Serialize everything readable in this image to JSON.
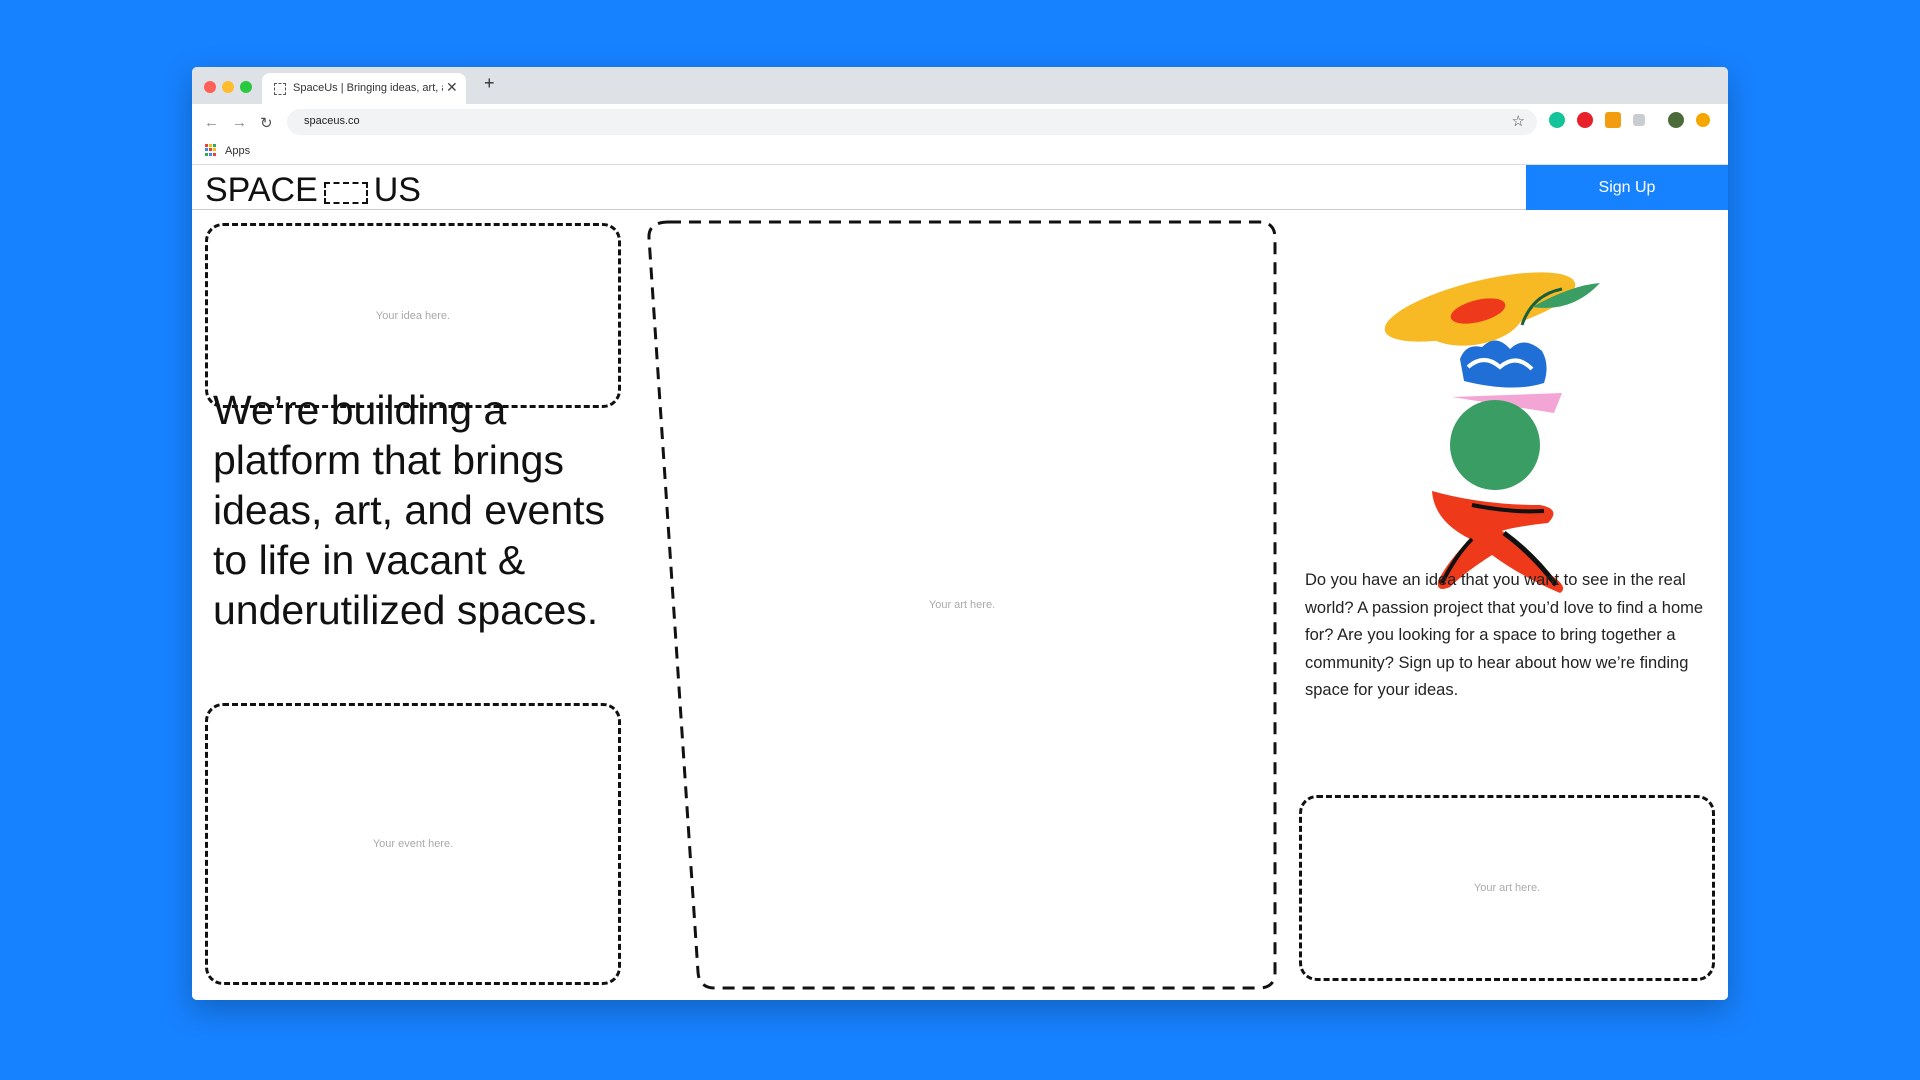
{
  "browser": {
    "tab_title": "SpaceUs | Bringing ideas, art, and events to life",
    "tab_close": "✕",
    "new_tab": "+",
    "back": "←",
    "forward": "→",
    "reload": "↻",
    "url": "spaceus.co",
    "star": "☆",
    "bookmarks_apps": "Apps",
    "extensions": [
      "grammarly-icon",
      "opera-icon",
      "translate-icon",
      "extension-icon",
      "avatar-icon",
      "alert-icon"
    ]
  },
  "site": {
    "logo_left": "SPACE",
    "logo_right": "US",
    "signup_label": "Sign Up",
    "accent_color": "#1782ff",
    "headline": "We’re building a platform that brings ideas, art, and events to life in vacant & underutilized spaces.",
    "placeholders": {
      "idea": "Your idea here.",
      "event": "Your event here.",
      "art_center": "Your art here.",
      "art_right": "Your art here."
    },
    "body": "Do you have an idea that you want to see in the real world? A passion project that you’d love to find a home for? Are you looking for a space to bring together a community? Sign up to hear about how we’re finding space for your ideas."
  }
}
